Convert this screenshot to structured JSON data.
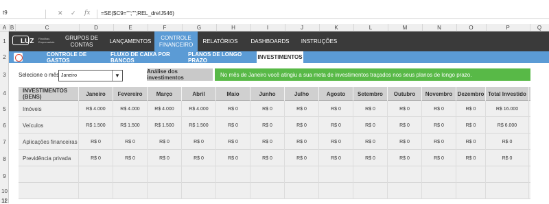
{
  "formula_bar": {
    "cell_ref": "t9",
    "formula": "=SE($C9=\"\";\"\";REL_dre!J546)",
    "cancel_glyph": "✕",
    "confirm_glyph": "✓",
    "fx_glyph": "fx"
  },
  "columns": [
    "A",
    "B",
    "C",
    "D",
    "E",
    "F",
    "G",
    "H",
    "I",
    "J",
    "K",
    "L",
    "M",
    "N",
    "O",
    "P",
    "Q"
  ],
  "rows": [
    "1",
    "2",
    "3",
    "4",
    "5",
    "6",
    "7",
    "8",
    "9",
    "10",
    "11",
    "12"
  ],
  "brand": {
    "logo": "LUZ",
    "tagline": "Planilhas Empresariais",
    "play_icon": "play-icon"
  },
  "nav": {
    "items": [
      {
        "label": "GRUPOS DE CONTAS",
        "active": false
      },
      {
        "label": "LANÇAMENTOS",
        "active": false
      },
      {
        "label": "CONTROLE FINANCEIRO",
        "active": true
      },
      {
        "label": "RELATÓRIOS",
        "active": false
      },
      {
        "label": "DASHBOARDS",
        "active": false
      },
      {
        "label": "INSTRUÇÕES",
        "active": false
      }
    ]
  },
  "subnav": {
    "items": [
      {
        "label": "CONTROLE DE GASTOS",
        "active": false
      },
      {
        "label": "FLUXO DE CAIXA POR BANCOS",
        "active": false
      },
      {
        "label": "PLANOS DE LONGO PRAZO",
        "active": false
      },
      {
        "label": "INVESTIMENTOS",
        "active": true
      }
    ]
  },
  "month_select": {
    "label": "Selecione o mês:",
    "value": "Janeiro",
    "arrow": "▼"
  },
  "analysis": {
    "label": "Análise dos investimentos",
    "message": "No mês de Janeiro você atingiu a sua meta de investimentos traçados nos seus planos de longo prazo.",
    "message_color": "#58b947"
  },
  "table": {
    "headers": [
      "INVESTIMENTOS (BENS)",
      "Janeiro",
      "Fevereiro",
      "Março",
      "Abril",
      "Maio",
      "Junho",
      "Julho",
      "Agosto",
      "Setembro",
      "Outubro",
      "Novembro",
      "Dezembro",
      "Total Investido"
    ],
    "rows": [
      [
        "Imóveis",
        "R$ 4.000",
        "R$ 4.000",
        "R$ 4.000",
        "R$ 4.000",
        "R$ 0",
        "R$ 0",
        "R$ 0",
        "R$ 0",
        "R$ 0",
        "R$ 0",
        "R$ 0",
        "R$ 0",
        "R$ 16.000"
      ],
      [
        "Veículos",
        "R$ 1.500",
        "R$ 1.500",
        "R$ 1.500",
        "R$ 1.500",
        "R$ 0",
        "R$ 0",
        "R$ 0",
        "R$ 0",
        "R$ 0",
        "R$ 0",
        "R$ 0",
        "R$ 0",
        "R$ 6.000"
      ],
      [
        "Aplicações financeiras",
        "R$ 0",
        "R$ 0",
        "R$ 0",
        "R$ 0",
        "R$ 0",
        "R$ 0",
        "R$ 0",
        "R$ 0",
        "R$ 0",
        "R$ 0",
        "R$ 0",
        "R$ 0",
        "R$ 0"
      ],
      [
        "Previdência privada",
        "R$ 0",
        "R$ 0",
        "R$ 0",
        "R$ 0",
        "R$ 0",
        "R$ 0",
        "R$ 0",
        "R$ 0",
        "R$ 0",
        "R$ 0",
        "R$ 0",
        "R$ 0",
        "R$ 0"
      ],
      [
        "",
        "",
        "",
        "",
        "",
        "",
        "",
        "",
        "",
        "",
        "",
        "",
        "",
        ""
      ],
      [
        "",
        "",
        "",
        "",
        "",
        "",
        "",
        "",
        "",
        "",
        "",
        "",
        "",
        ""
      ]
    ]
  },
  "colors": {
    "nav_bg": "#3a3a3a",
    "accent": "#5b9bd5",
    "success": "#58b947"
  }
}
